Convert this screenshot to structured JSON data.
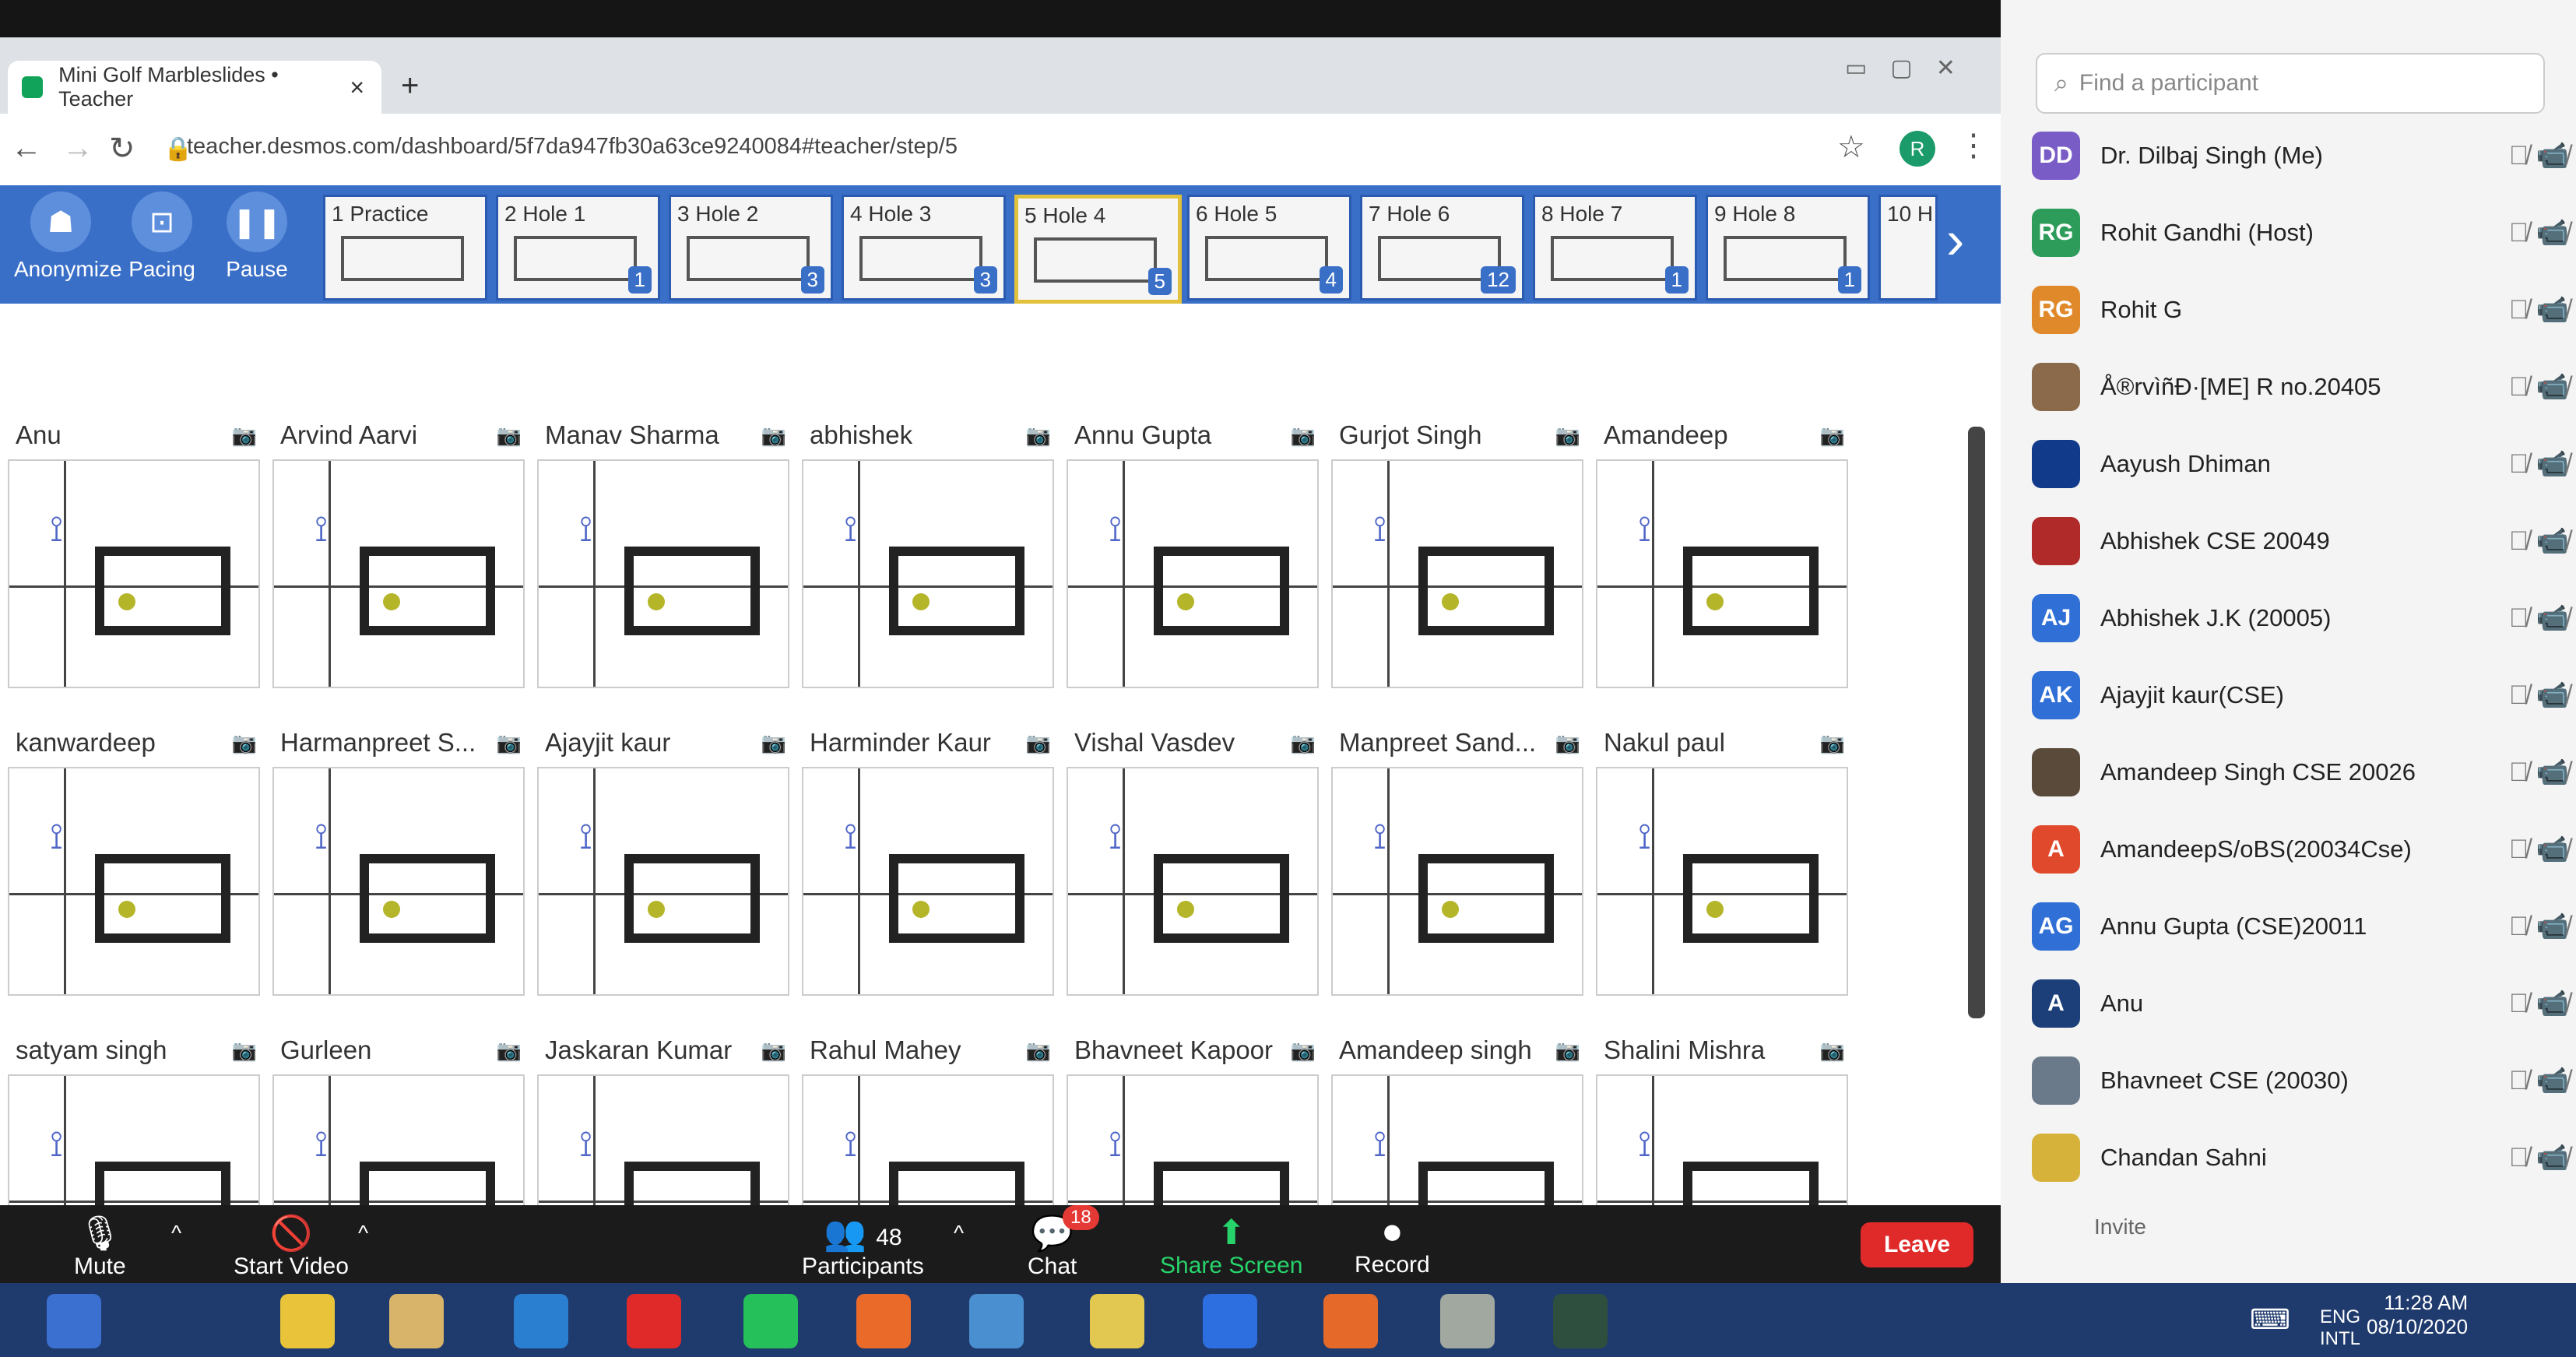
{
  "browser": {
    "tab_title": "Mini Golf Marbleslides • Teacher",
    "new_tab": "+",
    "url": "teacher.desmos.com/dashboard/5f7da947fb30a63ce9240084#teacher/step/5",
    "profile_initial": "R"
  },
  "toolbar": {
    "buttons": [
      {
        "label": "Anonymize",
        "icon": "incognito-icon"
      },
      {
        "label": "Pacing",
        "icon": "pacing-icon"
      },
      {
        "label": "Pause",
        "icon": "pause-icon"
      }
    ],
    "screens": [
      {
        "label": "1 Practice",
        "count": ""
      },
      {
        "label": "2 Hole 1",
        "count": "1"
      },
      {
        "label": "3 Hole 2",
        "count": "3"
      },
      {
        "label": "4 Hole 3",
        "count": "3"
      },
      {
        "label": "5 Hole 4",
        "count": "5",
        "active": true
      },
      {
        "label": "6 Hole 5",
        "count": "4"
      },
      {
        "label": "7 Hole 6",
        "count": "12"
      },
      {
        "label": "8 Hole 7",
        "count": "1"
      },
      {
        "label": "9 Hole 8",
        "count": "1"
      },
      {
        "label": "10 H",
        "count": ""
      }
    ]
  },
  "students": [
    [
      "Anu",
      "Arvind Aarvi",
      "Manav Sharma",
      "abhishek",
      "Annu Gupta",
      "Gurjot Singh",
      "Amandeep"
    ],
    [
      "kanwardeep",
      "Harmanpreet S...",
      "Ajayjit kaur",
      "Harminder Kaur",
      "Vishal Vasdev",
      "Manpreet Sand...",
      "Nakul paul"
    ],
    [
      "satyam singh",
      "Gurleen",
      "Jaskaran Kumar",
      "Rahul Mahey",
      "Bhavneet Kapoor",
      "Amandeep singh",
      "Shalini Mishra"
    ]
  ],
  "zoom": {
    "mute": "Mute",
    "start_video": "Start Video",
    "participants_count": "48",
    "participants": "Participants",
    "chat": "Chat",
    "chat_badge": "18",
    "share": "Share Screen",
    "record": "Record",
    "leave": "Leave"
  },
  "panel": {
    "search_placeholder": "Find a participant",
    "participants": [
      {
        "initials": "DD",
        "name": "Dr. Dilbaj Singh (Me)",
        "color": "#7a5cc7"
      },
      {
        "initials": "RG",
        "name": "Rohit Gandhi (Host)",
        "color": "#2d9c5a"
      },
      {
        "initials": "RG",
        "name": "Rohit G",
        "color": "#e0892b"
      },
      {
        "initials": "",
        "name": "Å®rvìñÐ·[ME] R no.20405",
        "color": "#8a6a4a"
      },
      {
        "initials": "",
        "name": "Aayush Dhiman",
        "color": "#123a8a"
      },
      {
        "initials": "",
        "name": "Abhishek CSE 20049",
        "color": "#b02a2a"
      },
      {
        "initials": "AJ",
        "name": "Abhishek J.K (20005)",
        "color": "#2f6fd6"
      },
      {
        "initials": "AK",
        "name": "Ajayjit kaur(CSE)",
        "color": "#2f6fd6"
      },
      {
        "initials": "",
        "name": "Amandeep Singh CSE 20026",
        "color": "#5a4a3a"
      },
      {
        "initials": "A",
        "name": "AmandeepS/oBS(20034Cse)",
        "color": "#e0492b"
      },
      {
        "initials": "AG",
        "name": "Annu Gupta (CSE)20011",
        "color": "#2f6fd6"
      },
      {
        "initials": "A",
        "name": "Anu",
        "color": "#1c3f7a"
      },
      {
        "initials": "",
        "name": "Bhavneet CSE (20030)",
        "color": "#6a7a8a"
      },
      {
        "initials": "",
        "name": "Chandan Sahni",
        "color": "#d6b23a"
      }
    ],
    "invite": "Invite"
  },
  "taskbar": {
    "lang1": "ENG",
    "lang2": "INTL",
    "time": "11:28 AM",
    "date": "08/10/2020"
  }
}
